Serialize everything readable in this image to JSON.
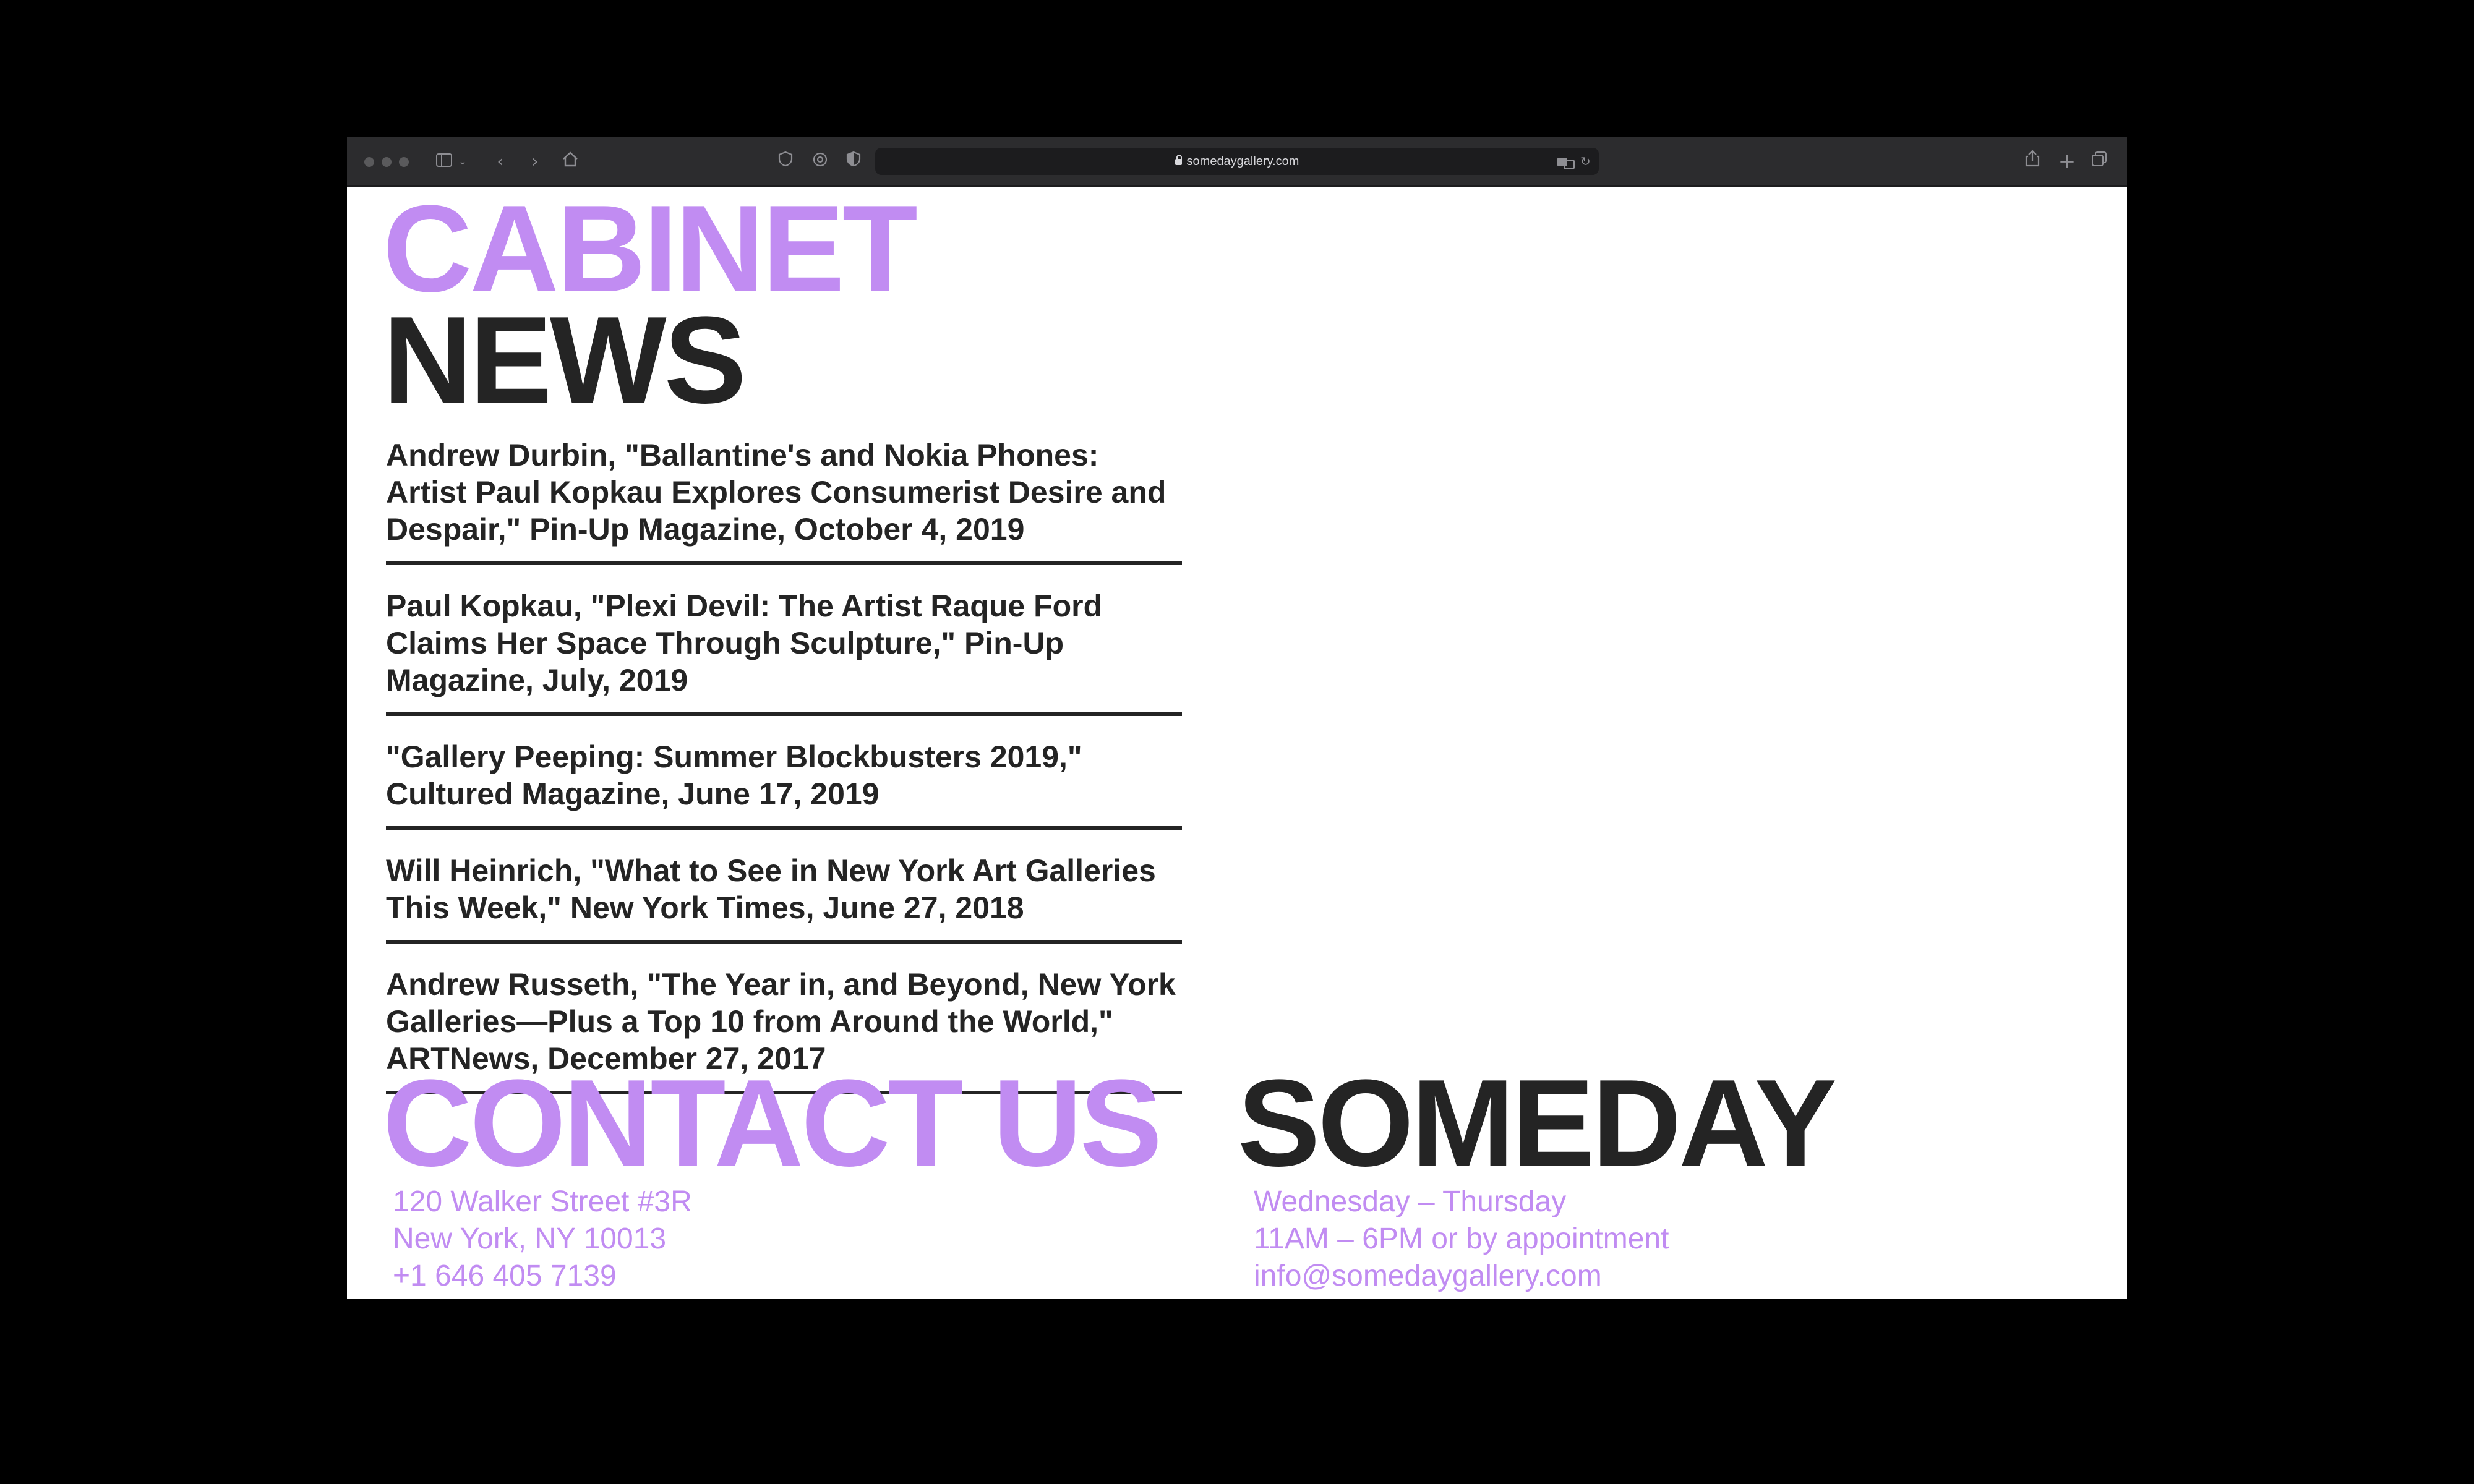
{
  "browser": {
    "url": "somedaygallery.com"
  },
  "page": {
    "section_title_1": "CABINET",
    "section_title_2": "NEWS",
    "news": [
      {
        "text": "Andrew Durbin, \"Ballantine's and Nokia Phones: Artist Paul Kopkau Explores Consumerist Desire and Despair,\" Pin-Up Magazine, October 4, 2019"
      },
      {
        "text": "Paul Kopkau, \"Plexi Devil: The Artist Raque Ford Claims Her Space Through Sculpture,\" Pin-Up Magazine, July, 2019"
      },
      {
        "text": "\"Gallery Peeping: Summer Blockbusters 2019,\" Cultured Magazine, June 17, 2019"
      },
      {
        "text": "Will Heinrich, \"What to See in New York Art Galleries This Week,\" New York Times, June 27, 2018"
      },
      {
        "text": "Andrew Russeth, \"The Year in, and Beyond, New York Galleries—Plus a Top 10 from Around the World,\" ARTNews, December 27, 2017"
      }
    ],
    "contact_title": "CONTACT US",
    "brand_title": "SOMEDAY",
    "address": {
      "line1": "120 Walker Street #3R",
      "line2": "New York, NY 10013",
      "phone": "+1 646 405 7139"
    },
    "hours": {
      "days": "Wednesday – Thursday",
      "time": "11AM – 6PM or by appointment",
      "email": "info@somedaygallery.com"
    }
  },
  "colors": {
    "accent": "#c18cf2",
    "text": "#242424",
    "toolbar": "#2c2c2e"
  }
}
